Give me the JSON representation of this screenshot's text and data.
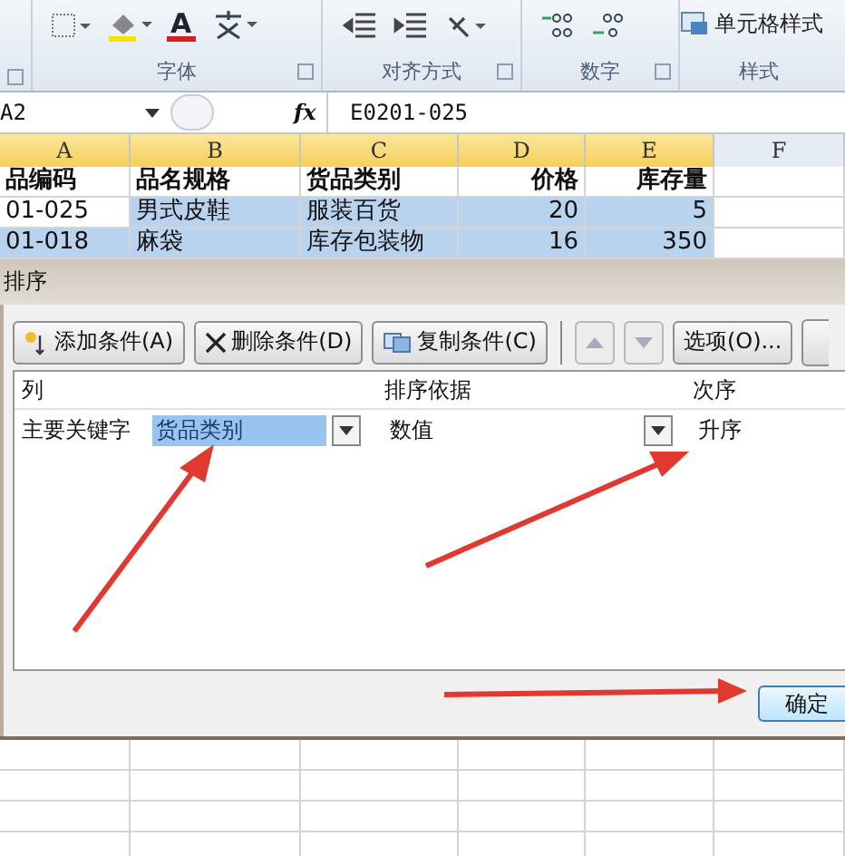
{
  "ribbon": {
    "cell_styles_button": "单元格样式",
    "font_color_glyph": "A",
    "groups": [
      {
        "label": "字体"
      },
      {
        "label": "对齐方式"
      },
      {
        "label": "数字"
      },
      {
        "label": "样式"
      }
    ]
  },
  "formula_bar": {
    "name_box": "A2",
    "fx_label": "fx",
    "value": "E0201-025"
  },
  "sheet": {
    "columns": [
      "A",
      "B",
      "C",
      "D",
      "E",
      "F"
    ],
    "rows": [
      {
        "cells": [
          {
            "text": "品编码",
            "selected": false
          },
          {
            "text": "品名规格",
            "selected": false
          },
          {
            "text": "货品类别",
            "selected": false
          },
          {
            "text": "价格",
            "selected": false
          },
          {
            "text": "库存量",
            "selected": false
          },
          {
            "text": "",
            "selected": false
          }
        ],
        "kind": "header"
      },
      {
        "cells": [
          {
            "text": "01-025",
            "selected": false
          },
          {
            "text": "男式皮鞋",
            "selected": true
          },
          {
            "text": "服装百货",
            "selected": true
          },
          {
            "text": "20",
            "selected": true
          },
          {
            "text": "5",
            "selected": true
          },
          {
            "text": "",
            "selected": false
          }
        ],
        "kind": "data"
      },
      {
        "cells": [
          {
            "text": "01-018",
            "selected": true
          },
          {
            "text": "麻袋",
            "selected": true
          },
          {
            "text": "库存包装物",
            "selected": true
          },
          {
            "text": "16",
            "selected": true
          },
          {
            "text": "350",
            "selected": true
          },
          {
            "text": "",
            "selected": false
          }
        ],
        "kind": "data"
      }
    ]
  },
  "dialog": {
    "title": "排序",
    "toolbar": [
      {
        "label": "添加条件(A)",
        "kind": "add"
      },
      {
        "label": "删除条件(D)",
        "kind": "delete"
      },
      {
        "label": "复制条件(C)",
        "kind": "copy"
      },
      {
        "kind": "up",
        "disabled": true
      },
      {
        "kind": "down",
        "disabled": true
      },
      {
        "label": "选项(O)...",
        "kind": "options"
      }
    ],
    "headers": [
      "列",
      "排序依据",
      "次序"
    ],
    "rows": [
      {
        "label": "主要关键字",
        "column": "货品类别",
        "sort_on": "数值",
        "order": "升序",
        "selected": true
      }
    ],
    "ok_button": "确定"
  }
}
